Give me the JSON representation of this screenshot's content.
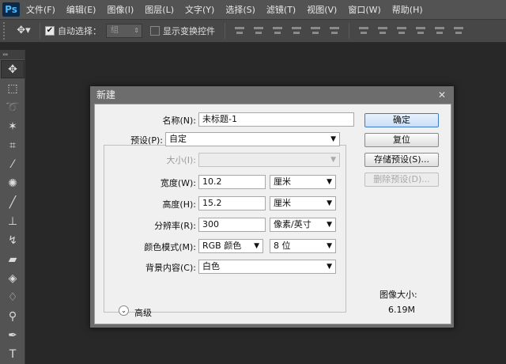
{
  "app": {
    "logo": "Ps"
  },
  "menubar": {
    "items": [
      "文件(F)",
      "编辑(E)",
      "图像(I)",
      "图层(L)",
      "文字(Y)",
      "选择(S)",
      "滤镜(T)",
      "视图(V)",
      "窗口(W)",
      "帮助(H)"
    ]
  },
  "options": {
    "move_tool_icon": "move-tool-icon",
    "auto_select_label": "自动选择：",
    "auto_select_checked": true,
    "auto_select_target": "组",
    "show_transform_label": "显示变换控件",
    "show_transform_checked": false
  },
  "toolpanel": {
    "header": "»»",
    "tools": [
      "move",
      "marquee",
      "lasso",
      "magic-wand",
      "crop",
      "eyedropper",
      "spot-healing",
      "brush",
      "clone-stamp",
      "history-brush",
      "eraser",
      "paint-bucket",
      "blur",
      "dodge",
      "pen",
      "type"
    ]
  },
  "dialog": {
    "title": "新建",
    "close": "✕",
    "name_label": "名称(N):",
    "name_value": "未标题-1",
    "preset_label": "预设(P):",
    "preset_value": "自定",
    "size_label": "大小(I):",
    "size_value": "",
    "width_label": "宽度(W):",
    "width_value": "10.2",
    "width_unit": "厘米",
    "height_label": "高度(H):",
    "height_value": "15.2",
    "height_unit": "厘米",
    "resolution_label": "分辨率(R):",
    "resolution_value": "300",
    "resolution_unit": "像素/英寸",
    "color_mode_label": "颜色模式(M):",
    "color_mode_value": "RGB 颜色",
    "bit_depth_value": "8 位",
    "background_label": "背景内容(C):",
    "background_value": "白色",
    "advanced_label": "高级",
    "ok_label": "确定",
    "reset_label": "复位",
    "save_preset_label": "存储预设(S)...",
    "delete_preset_label": "删除预设(D)...",
    "image_size_label": "图像大小:",
    "image_size_value": "6.19M"
  },
  "colors": {
    "menubar": "#535353",
    "workspace": "#282828",
    "dialog_body": "#f0f0f0",
    "primary_button_border": "#3d7bc7"
  }
}
